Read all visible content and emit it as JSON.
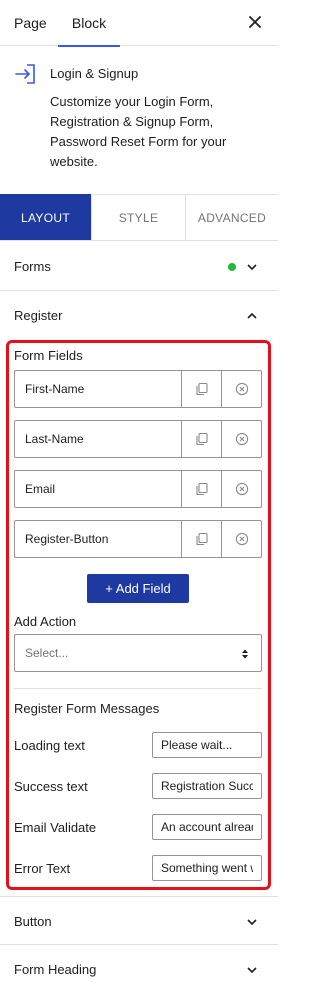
{
  "header": {
    "tabs": [
      {
        "label": "Page",
        "active": false
      },
      {
        "label": "Block",
        "active": true
      }
    ],
    "close_icon": "close-icon"
  },
  "block": {
    "icon": "login-arrow-icon",
    "title": "Login & Signup",
    "description": "Customize your Login Form, Registration & Signup Form, Password Reset Form for your website."
  },
  "subtabs": [
    {
      "label": "LAYOUT",
      "active": true
    },
    {
      "label": "STYLE",
      "active": false
    },
    {
      "label": "ADVANCED",
      "active": false
    }
  ],
  "panels": {
    "forms": {
      "label": "Forms",
      "expanded": false,
      "status": "green-dot"
    },
    "register": {
      "label": "Register",
      "expanded": true
    },
    "button": {
      "label": "Button",
      "expanded": false
    },
    "form_heading": {
      "label": "Form Heading",
      "expanded": false
    }
  },
  "register": {
    "form_fields_title": "Form Fields",
    "fields": [
      {
        "name": "First-Name"
      },
      {
        "name": "Last-Name"
      },
      {
        "name": "Email"
      },
      {
        "name": "Register-Button"
      }
    ],
    "add_field_label": "+ Add Field",
    "add_action_label": "Add Action",
    "add_action_placeholder": "Select...",
    "messages_title": "Register Form Messages",
    "messages": [
      {
        "label": "Loading text",
        "value": "Please wait..."
      },
      {
        "label": "Success text",
        "value": "Registration Successful"
      },
      {
        "label": "Email Validate",
        "value": "An account already exists"
      },
      {
        "label": "Error Text",
        "value": "Something went wrong"
      }
    ]
  },
  "colors": {
    "accent": "#1e3aa0",
    "tab_underline": "#3858e9",
    "highlight": "#e3111b",
    "status_dot": "#22bb33"
  }
}
